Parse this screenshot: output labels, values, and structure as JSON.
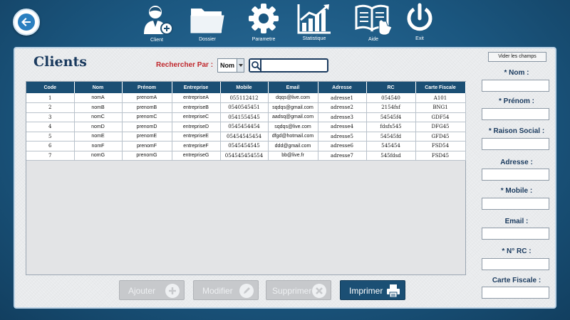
{
  "toolbar": {
    "items": [
      {
        "label": "Client",
        "icon": "user-icon"
      },
      {
        "label": "Dossier",
        "icon": "folder-icon"
      },
      {
        "label": "Parametre",
        "icon": "gear-icon"
      },
      {
        "label": "Statistique",
        "icon": "chart-icon"
      },
      {
        "label": "Aide",
        "icon": "book-hand-icon"
      },
      {
        "label": "Exit",
        "icon": "power-icon"
      }
    ]
  },
  "page": {
    "title": "Clients"
  },
  "search": {
    "label": "Rechercher Par :",
    "field": "Nom",
    "value": ""
  },
  "table": {
    "columns": [
      "Code",
      "Nom",
      "Prénom",
      "Entreprise",
      "Mobile",
      "Email",
      "Adresse",
      "RC",
      "Carte Fiscale"
    ],
    "rows": [
      [
        "1",
        "nomA",
        "prenomA",
        "entrepriseA",
        "055112412",
        "dqqs@live.com",
        "adresse1",
        "054540",
        "A101"
      ],
      [
        "2",
        "nomB",
        "prenomB",
        "entrepriseB",
        "0540545451",
        "sqdqs@gmail.com",
        "adresse2",
        "2154fsf",
        "BNG1"
      ],
      [
        "3",
        "nomC",
        "prenomC",
        "entrepriseC",
        "0541554545",
        "aadsq@gmail.com",
        "adresse3",
        "54545f4",
        "GDF54"
      ],
      [
        "4",
        "nomD",
        "prenomD",
        "entrepriseD",
        "0545454454",
        "sqdqs@live.com",
        "adresse4",
        "fdsfs545",
        "DFG45"
      ],
      [
        "5",
        "nomE",
        "prenomE",
        "entrepriseE",
        "05454545454",
        "dfgd@hotmail.com",
        "adresse5",
        "54545fd",
        "GFD45"
      ],
      [
        "6",
        "nomF",
        "prenomF",
        "entrepriseF",
        "0545454545",
        "ddd@gmail.com",
        "adresse6",
        "545454",
        "FSD54"
      ],
      [
        "7",
        "nomG",
        "prenomG",
        "entrepriseG",
        "054545454554",
        "bb@live.fr",
        "adresse7",
        "545fdsd",
        "FSD45"
      ]
    ]
  },
  "actions": {
    "ajouter": "Ajouter",
    "modifier": "Modifier",
    "supprimer": "Supprimer",
    "imprimer": "Imprimer"
  },
  "form": {
    "clear": "Vider les champs",
    "nom": "* Nom :",
    "prenom": "* Prénom :",
    "raison": "* Raison Social :",
    "adresse": "Adresse :",
    "mobile": "* Mobile :",
    "email": "Email :",
    "rc": "* N° RC :",
    "carte": "Carte Fiscale :"
  },
  "colors": {
    "primary": "#1b4f74",
    "accent_red": "#c0282d",
    "background": "#1b5780"
  }
}
